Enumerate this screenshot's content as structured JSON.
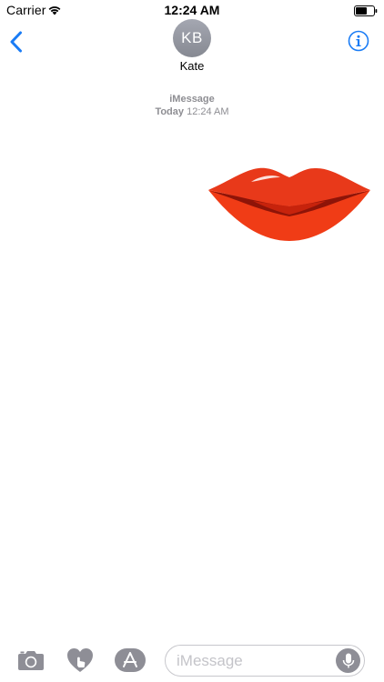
{
  "status_bar": {
    "carrier": "Carrier",
    "time": "12:24 AM"
  },
  "header": {
    "avatar_initials": "KB",
    "contact_name": "Kate"
  },
  "thread": {
    "service_label": "iMessage",
    "day_label": "Today",
    "time_label": "12:24 AM"
  },
  "sticker": {
    "icon": "red-lips-sticker",
    "color": "#e8391a"
  },
  "compose": {
    "placeholder": "iMessage"
  },
  "colors": {
    "accent": "#1a7cf5",
    "avatar": "#9a9da6",
    "tool_icons": "#8e8e96"
  }
}
